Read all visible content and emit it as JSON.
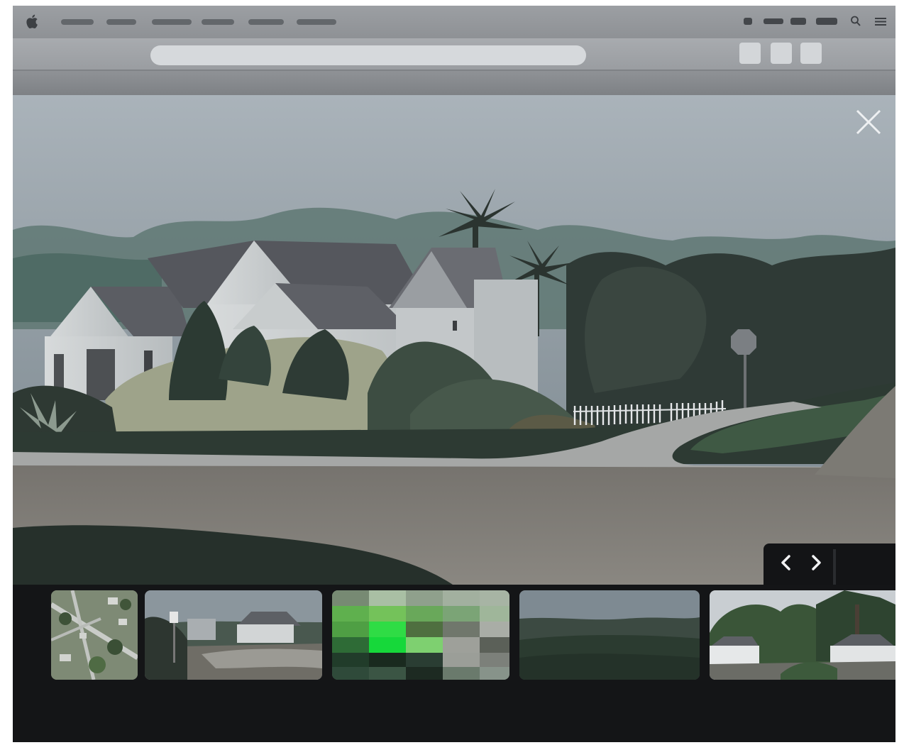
{
  "window": {
    "menubar_items": [
      "",
      "",
      "",
      "",
      "",
      ""
    ],
    "icons": {
      "apple": "apple-icon",
      "search": "search-icon",
      "menu": "menu-icon",
      "close": "close-icon",
      "prev": "chevron-left-icon",
      "next": "chevron-right-icon"
    }
  },
  "toolbar": {
    "address_value": "",
    "buttons": [
      "",
      "",
      ""
    ]
  },
  "viewer": {
    "image_alt": ""
  },
  "filmstrip": {
    "thumbnails": [
      {
        "kind": "aerial-map"
      },
      {
        "kind": "street-house"
      },
      {
        "kind": "green-pixel-grid",
        "selected": true
      },
      {
        "kind": "open-field"
      },
      {
        "kind": "houses-trees"
      }
    ]
  },
  "colors": {
    "menubar": "#969a9e",
    "toolbar": "#a3a6aa",
    "filmstrip_bg": "#141517",
    "accent_green": "#2fdc45"
  }
}
